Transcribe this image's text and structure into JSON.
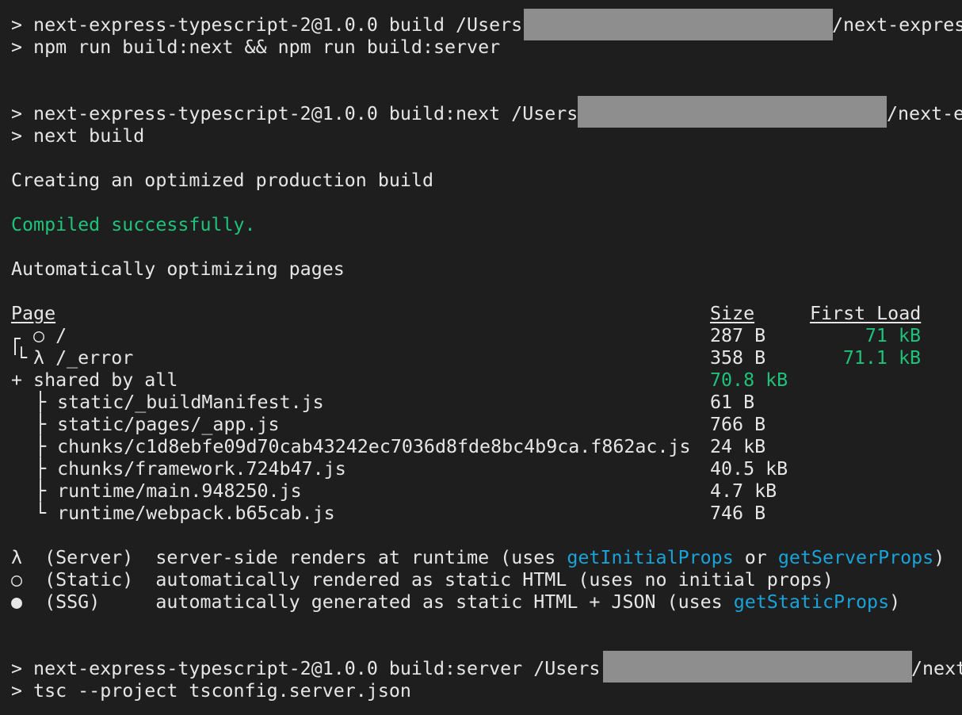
{
  "lines": {
    "l1_prefix": "> next-express-typescript-2@1.0.0 build /Users",
    "l1_suffix": "/next-expres",
    "l2": "> npm run build:next && npm run build:server",
    "l3_prefix": "> next-express-typescript-2@1.0.0 build:next /Users",
    "l3_suffix": "/next-e",
    "l4": "> next build",
    "l5": "Creating an optimized production build",
    "l6": "Compiled successfully.",
    "l7": "Automatically optimizing pages",
    "l8_prefix": "> next-express-typescript-2@1.0.0 build:server /Users",
    "l8_suffix": "/next",
    "l9": "> tsc --project tsconfig.server.json"
  },
  "table": {
    "headers": {
      "page": "Page",
      "size": "Size",
      "first_load": "First Load"
    },
    "pages": [
      {
        "marker": "○",
        "route": "/",
        "size": "287 B",
        "first_load": "71 kB"
      },
      {
        "marker": "λ",
        "route": "/_error",
        "size": "358 B",
        "first_load": "71.1 kB"
      }
    ],
    "shared": {
      "label": "+ shared by all",
      "size": "70.8 kB"
    },
    "chunks": [
      {
        "tree": "├",
        "name": "static/_buildManifest.js",
        "size": "61 B"
      },
      {
        "tree": "├",
        "name": "static/pages/_app.js",
        "size": "766 B"
      },
      {
        "tree": "├",
        "name": "chunks/c1d8ebfe09d70cab43242ec7036d8fde8bc4b9ca.f862ac.js",
        "size": "24 kB"
      },
      {
        "tree": "├",
        "name": "chunks/framework.724b47.js",
        "size": "40.5 kB"
      },
      {
        "tree": "├",
        "name": "runtime/main.948250.js",
        "size": "4.7 kB"
      },
      {
        "tree": "└",
        "name": "runtime/webpack.b65cab.js",
        "size": "746 B"
      }
    ]
  },
  "legend": [
    {
      "symbol": "λ",
      "type": "(Server)",
      "desc_a": "server-side renders at runtime (uses ",
      "link_a": "getInitialProps",
      "mid": " or ",
      "link_b": "getServerProps",
      "end": ")"
    },
    {
      "symbol": "○",
      "type": "(Static)",
      "desc_a": "automatically rendered as static HTML (uses no initial props)"
    },
    {
      "symbol": "●",
      "type": "(SSG)",
      "desc_a": "automatically generated as static HTML + JSON (uses ",
      "link_a": "getStaticProps",
      "end": ")"
    }
  ],
  "colors": {
    "background": "#1e1e1e",
    "text": "#e6e6e6",
    "success": "#1ec27a",
    "link": "#1aa3d9",
    "redaction": "#8e8e8e"
  }
}
